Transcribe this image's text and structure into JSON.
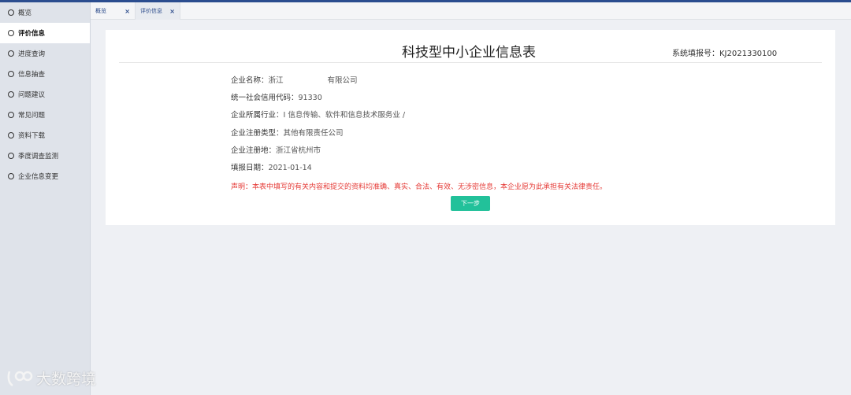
{
  "sidebar": {
    "items": [
      {
        "label": "概览",
        "active": false
      },
      {
        "label": "评价信息",
        "active": true
      },
      {
        "label": "进度查询",
        "active": false
      },
      {
        "label": "信息抽查",
        "active": false
      },
      {
        "label": "问题建议",
        "active": false
      },
      {
        "label": "常见问题",
        "active": false
      },
      {
        "label": "资料下载",
        "active": false
      },
      {
        "label": "季度调查监测",
        "active": false
      },
      {
        "label": "企业信息变更",
        "active": false
      }
    ]
  },
  "tabs": [
    {
      "label": "概览",
      "close": "×"
    },
    {
      "label": "评价信息",
      "close": "×"
    }
  ],
  "card": {
    "title": "科技型中小企业信息表",
    "system_no_label": "系统填报号：",
    "system_no": "KJ2021330100",
    "fields": [
      {
        "label": "企业名称：",
        "value": "浙江",
        "suffix": "有限公司"
      },
      {
        "label": "统一社会信用代码：",
        "value": "91330"
      },
      {
        "label": "企业所属行业：",
        "value": "I 信息传输、软件和信息技术服务业 /"
      },
      {
        "label": "企业注册类型：",
        "value": "其他有限责任公司"
      },
      {
        "label": "企业注册地：",
        "value": "浙江省杭州市"
      },
      {
        "label": "填报日期：",
        "value": "2021-01-14"
      }
    ],
    "declaration": "声明：本表中填写的有关内容和提交的资料均准确、真实、合法、有效、无涉密信息，本企业愿为此承担有关法律责任。",
    "next_button": "下一步"
  },
  "watermark": {
    "text": "大数跨境",
    "icon": "brand-logo-icon"
  },
  "colors": {
    "accent": "#22c19a",
    "declaration": "#e53935",
    "topline": "#2b4d8f"
  }
}
